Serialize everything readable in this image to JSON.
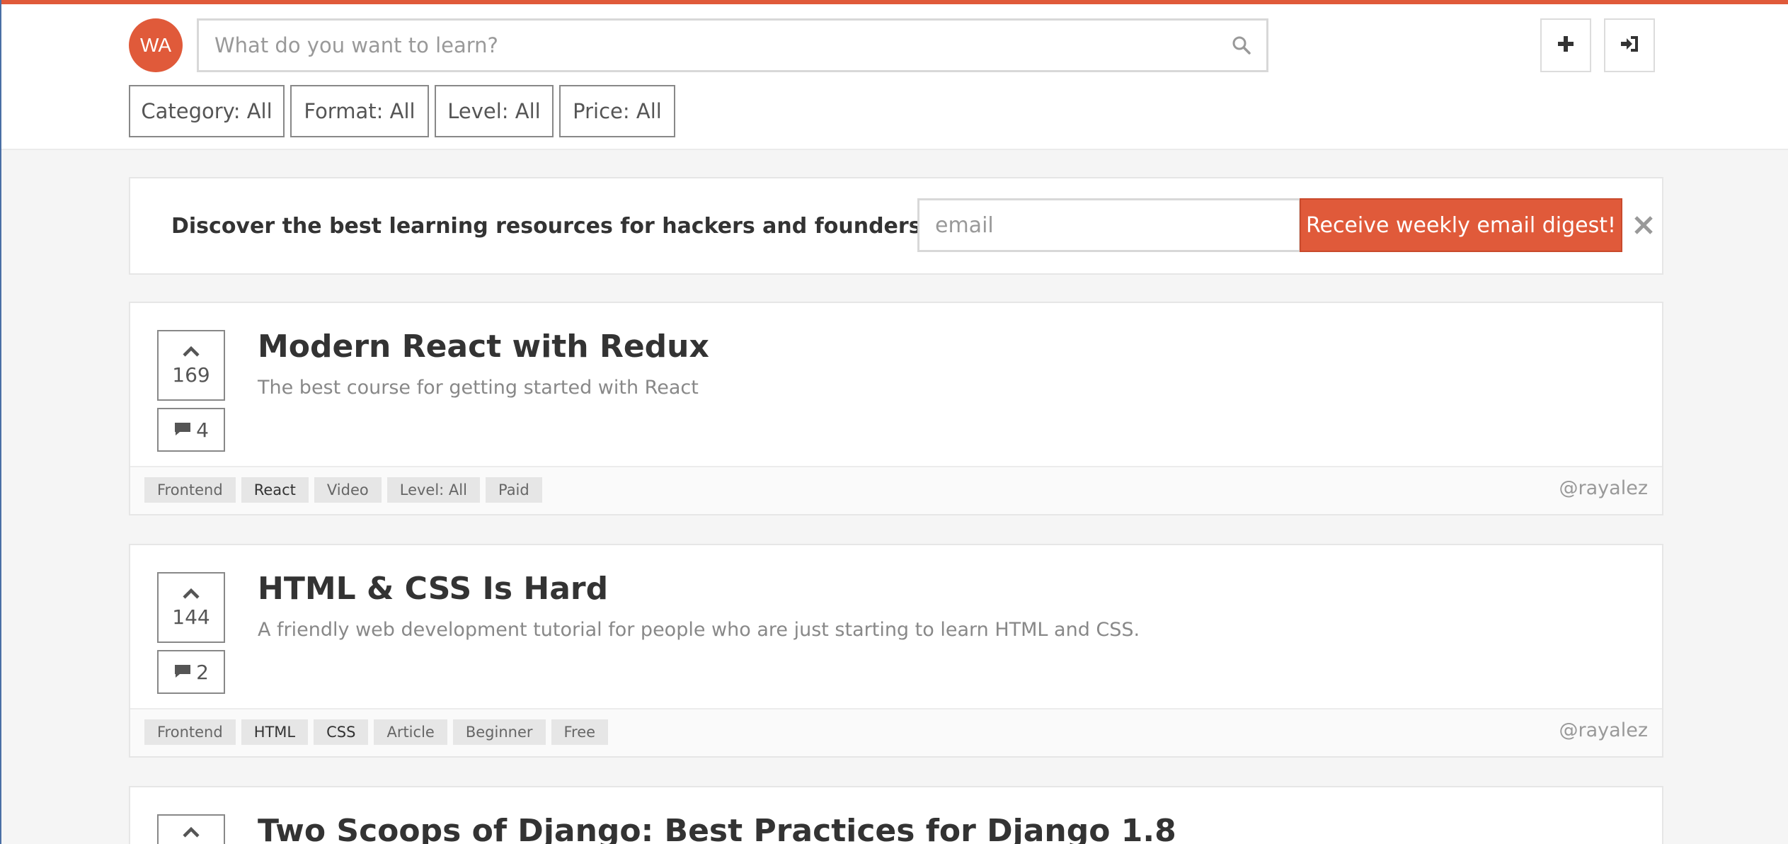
{
  "header": {
    "avatar_initials": "WA",
    "search_placeholder": "What do you want to learn?",
    "search_icon": "search-icon",
    "add_icon": "plus-icon",
    "login_icon": "sign-in-icon"
  },
  "filters": [
    {
      "label": "Category: All"
    },
    {
      "label": "Format: All"
    },
    {
      "label": "Level: All"
    },
    {
      "label": "Price: All"
    }
  ],
  "newsletter": {
    "message": "Discover the best learning resources for hackers and founders!",
    "email_placeholder": "email",
    "button_label": "Receive weekly email digest!",
    "close_icon": "close-icon"
  },
  "resources": [
    {
      "votes": "169",
      "comments": "4",
      "title": "Modern React with Redux",
      "description": "The best course for getting started with React",
      "tags": [
        "Frontend",
        "React",
        "Video",
        "Level: All",
        "Paid"
      ],
      "author": "@rayalez"
    },
    {
      "votes": "144",
      "comments": "2",
      "title": "HTML & CSS Is Hard",
      "description": "A friendly web development tutorial for people who are just starting to learn HTML and CSS.",
      "tags": [
        "Frontend",
        "HTML",
        "CSS",
        "Article",
        "Beginner",
        "Free"
      ],
      "author": "@rayalez"
    },
    {
      "title": "Two Scoops of Django: Best Practices for Django 1.8"
    }
  ],
  "colors": {
    "accent": "#e05a3a",
    "background": "#f5f5f5"
  }
}
